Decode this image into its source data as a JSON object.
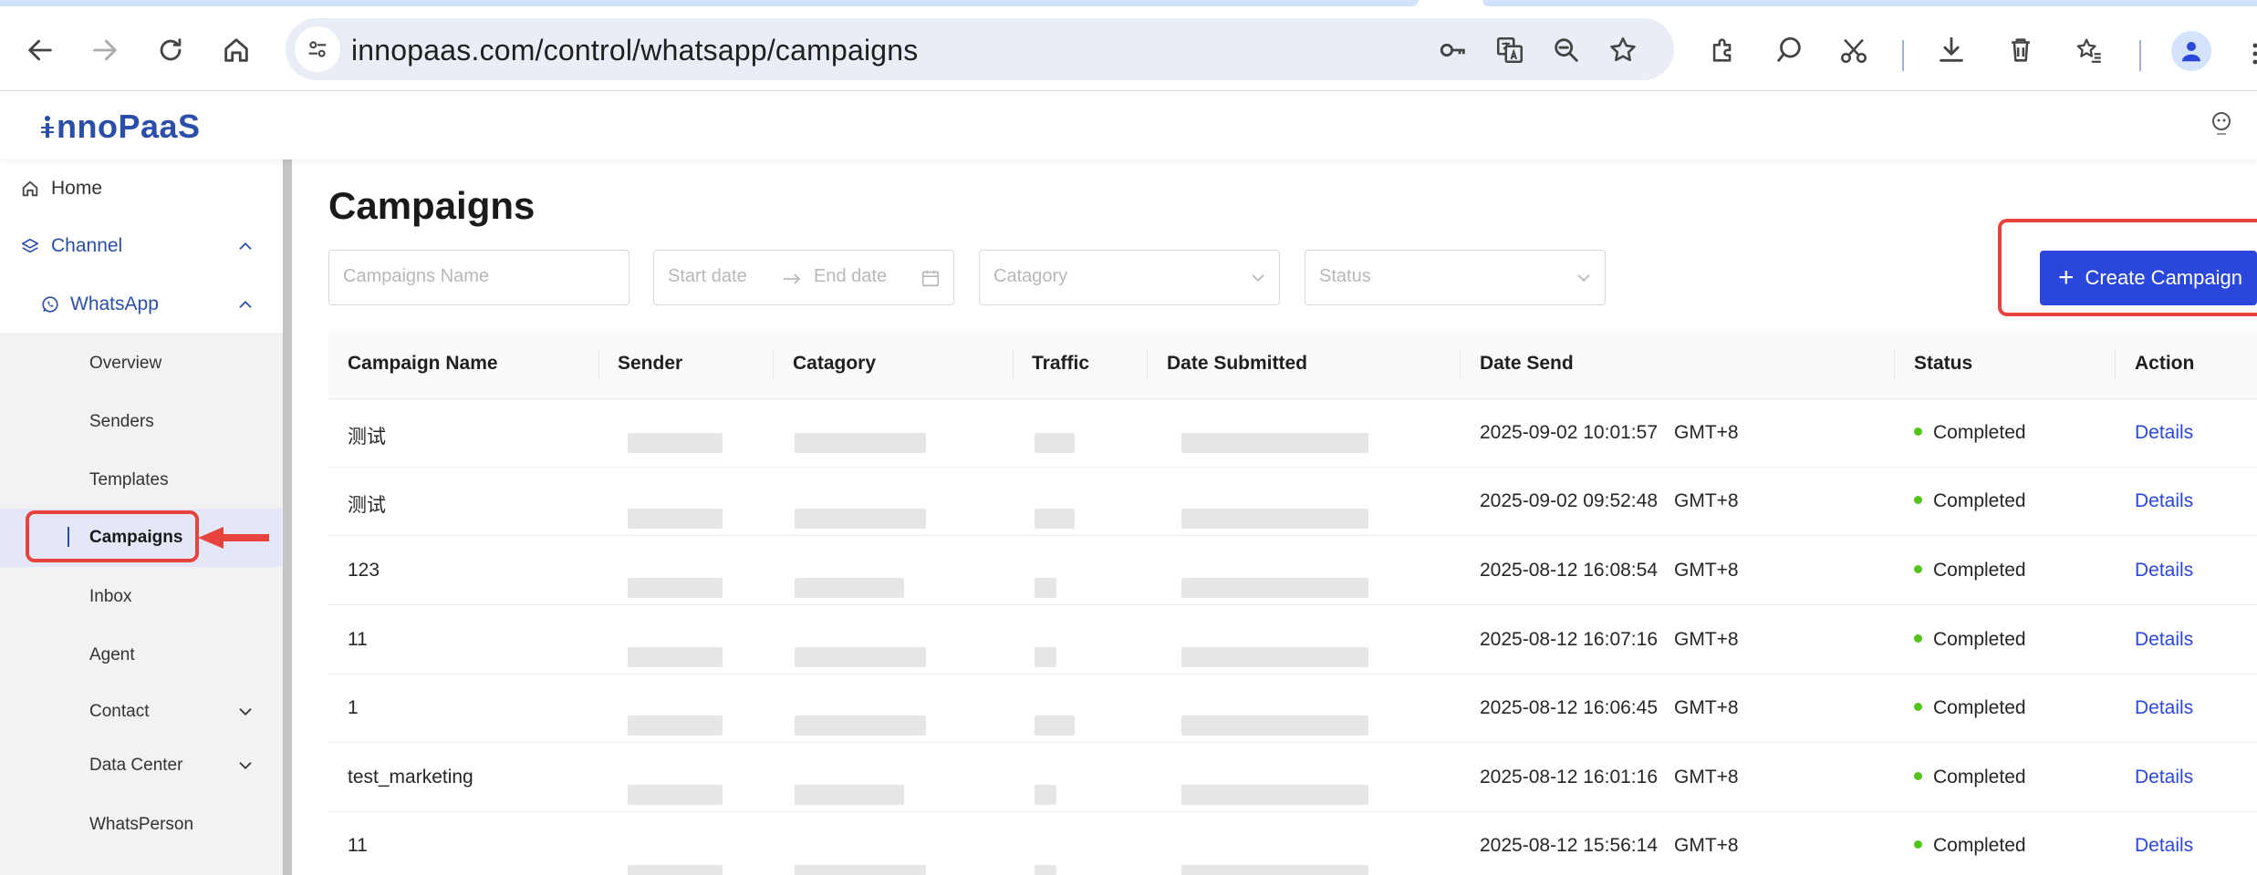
{
  "browser": {
    "url": "innopaas.com/control/whatsapp/campaigns"
  },
  "app": {
    "logo_text": "nnoPaaS"
  },
  "sidebar": {
    "home": "Home",
    "channel": "Channel",
    "whatsapp": "WhatsApp",
    "items": [
      {
        "label": "Overview"
      },
      {
        "label": "Senders"
      },
      {
        "label": "Templates"
      },
      {
        "label": "Campaigns",
        "active": true
      },
      {
        "label": "Inbox"
      },
      {
        "label": "Agent"
      },
      {
        "label": "Contact"
      },
      {
        "label": "Data Center"
      },
      {
        "label": "WhatsPerson"
      }
    ]
  },
  "page": {
    "title": "Campaigns"
  },
  "filters": {
    "name_placeholder": "Campaigns Name",
    "start_date_placeholder": "Start date",
    "end_date_placeholder": "End date",
    "category_placeholder": "Catagory",
    "status_placeholder": "Status",
    "create_label": "Create Campaign"
  },
  "table": {
    "columns": [
      "Campaign Name",
      "Sender",
      "Catagory",
      "Traffic",
      "Date Submitted",
      "Date Send",
      "Status",
      "Action"
    ],
    "rows": [
      {
        "name": "测试",
        "date_send": "2025-09-02 10:01:57",
        "tz": "GMT+8",
        "status": "Completed",
        "action": "Details"
      },
      {
        "name": "测试",
        "date_send": "2025-09-02 09:52:48",
        "tz": "GMT+8",
        "status": "Completed",
        "action": "Details"
      },
      {
        "name": "123",
        "date_send": "2025-08-12 16:08:54",
        "tz": "GMT+8",
        "status": "Completed",
        "action": "Details"
      },
      {
        "name": "11",
        "date_send": "2025-08-12 16:07:16",
        "tz": "GMT+8",
        "status": "Completed",
        "action": "Details"
      },
      {
        "name": "1",
        "date_send": "2025-08-12 16:06:45",
        "tz": "GMT+8",
        "status": "Completed",
        "action": "Details"
      },
      {
        "name": "test_marketing",
        "date_send": "2025-08-12 16:01:16",
        "tz": "GMT+8",
        "status": "Completed",
        "action": "Details"
      },
      {
        "name": "11",
        "date_send": "2025-08-12 15:56:14",
        "tz": "GMT+8",
        "status": "Completed",
        "action": "Details"
      }
    ]
  },
  "colors": {
    "brand": "#2b4fa8",
    "primary_button": "#2b47db",
    "status_completed": "#52c41a",
    "annotation": "#e8423f"
  }
}
